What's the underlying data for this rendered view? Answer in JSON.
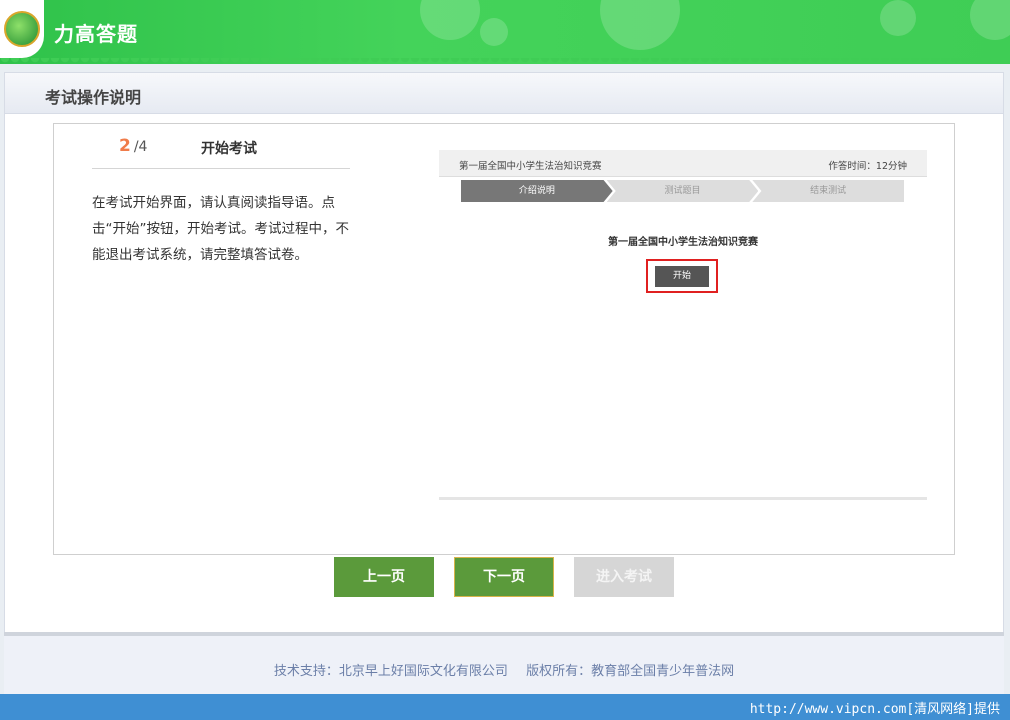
{
  "app": {
    "title": "力高答题"
  },
  "section": {
    "title": "考试操作说明"
  },
  "step": {
    "current": "2",
    "total": "/4",
    "title": "开始考试"
  },
  "description": "在考试开始界面，请认真阅读指导语。点击“开始”按钮，开始考试。考试过程中，不能退出考试系统，请完整填答试卷。",
  "preview": {
    "contest_name": "第一届全国中小学生法治知识竞赛",
    "time_label": "作答时间：12分钟",
    "tabs": [
      "介绍说明",
      "测试题目",
      "结束测试"
    ],
    "subtitle": "第一届全国中小学生法治知识竞赛",
    "start_button": "开始"
  },
  "buttons": {
    "prev": "上一页",
    "next": "下一页",
    "enter": "进入考试"
  },
  "footer": {
    "support": "技术支持：北京早上好国际文化有限公司",
    "copyright": "版权所有：教育部全国青少年普法网"
  },
  "watermark": "http://www.vipcn.com[清风网络]提供",
  "colors": {
    "header_green": "#3fcd55",
    "button_green": "#5b9a3b",
    "step_orange": "#f07c4a",
    "highlight_red": "#e02020"
  }
}
